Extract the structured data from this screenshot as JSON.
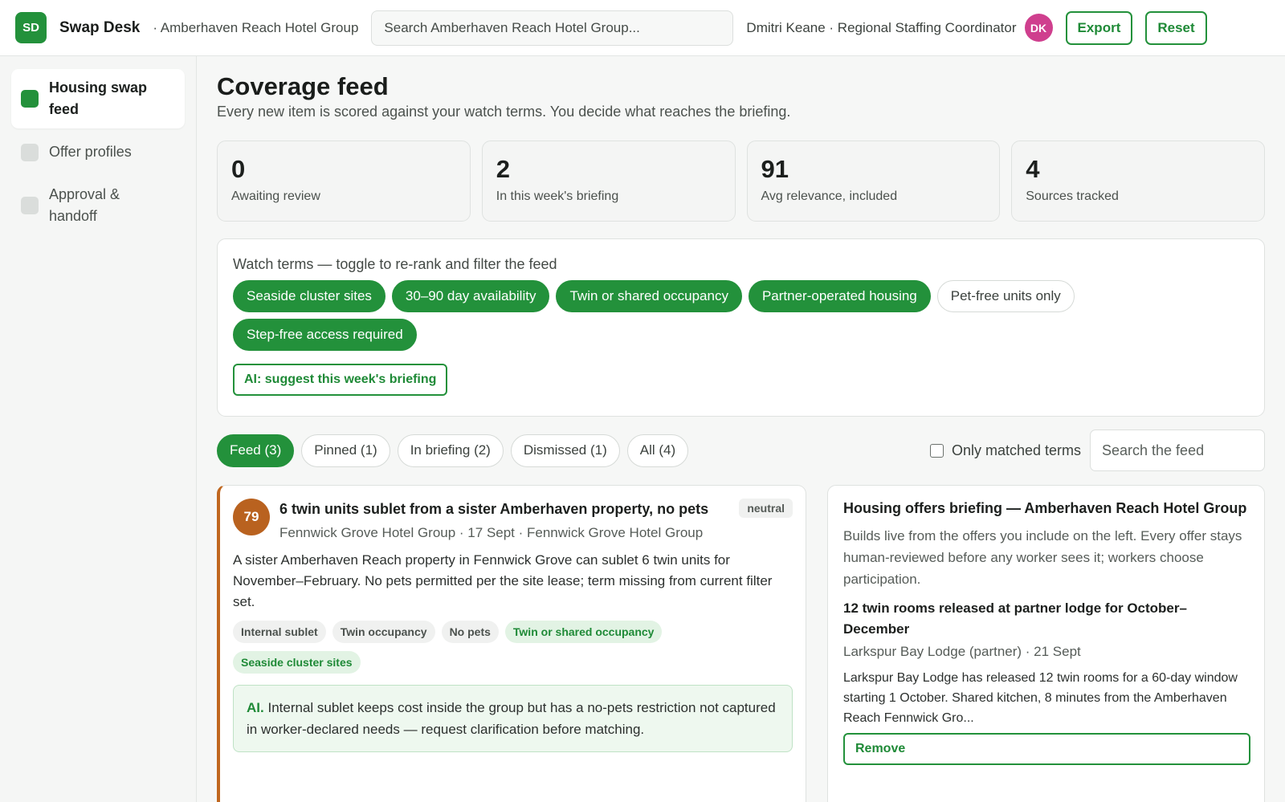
{
  "header": {
    "logo_text": "SD",
    "app_name": "Swap Desk",
    "org_name": "· Amberhaven Reach Hotel Group",
    "search_placeholder": "Search Amberhaven Reach Hotel Group...",
    "user": "Dmitri Keane · Regional Staffing Coordinator",
    "avatar_initials": "DK",
    "export_label": "Export",
    "reset_label": "Reset"
  },
  "sidebar": {
    "items": [
      {
        "label": "Housing swap feed",
        "active": true
      },
      {
        "label": "Offer profiles",
        "active": false
      },
      {
        "label": "Approval & handoff",
        "active": false
      }
    ]
  },
  "main": {
    "title": "Coverage feed",
    "subtitle": "Every new item is scored against your watch terms. You decide what reaches the briefing.",
    "stats": [
      {
        "value": "0",
        "label": "Awaiting review"
      },
      {
        "value": "2",
        "label": "In this week's briefing"
      },
      {
        "value": "91",
        "label": "Avg relevance, included"
      },
      {
        "value": "4",
        "label": "Sources tracked"
      }
    ],
    "watch": {
      "title": "Watch terms — toggle to re-rank and filter the feed",
      "terms": [
        {
          "label": "Seaside cluster sites",
          "on": true
        },
        {
          "label": "30–90 day availability",
          "on": true
        },
        {
          "label": "Twin or shared occupancy",
          "on": true
        },
        {
          "label": "Partner-operated housing",
          "on": true
        },
        {
          "label": "Pet-free units only",
          "on": false
        },
        {
          "label": "Step-free access required",
          "on": true
        }
      ],
      "ai_button": "AI: suggest this week's briefing"
    },
    "tabs": [
      {
        "label": "Feed (3)",
        "on": true
      },
      {
        "label": "Pinned (1)",
        "on": false
      },
      {
        "label": "In briefing (2)",
        "on": false
      },
      {
        "label": "Dismissed (1)",
        "on": false
      },
      {
        "label": "All (4)",
        "on": false
      }
    ],
    "only_matched_label": "Only matched terms",
    "feed_search_placeholder": "Search the feed"
  },
  "card": {
    "score": "79",
    "title": "6 twin units sublet from a sister Amberhaven property, no pets",
    "sentiment": "neutral",
    "meta": "Fennwick Grove Hotel Group · 17 Sept · Fennwick Grove Hotel Group",
    "body": "A sister Amberhaven Reach property in Fennwick Grove can sublet 6 twin units for November–February. No pets permitted per the site lease; term missing from current filter set.",
    "tags": [
      {
        "label": "Internal sublet",
        "match": false
      },
      {
        "label": "Twin occupancy",
        "match": false
      },
      {
        "label": "No pets",
        "match": false
      },
      {
        "label": "Twin or shared occupancy",
        "match": true
      },
      {
        "label": "Seaside cluster sites",
        "match": true
      }
    ],
    "ai_label": "AI.",
    "ai_text": "Internal sublet keeps cost inside the group but has a no-pets restriction not captured in worker-declared needs — request clarification before matching."
  },
  "briefing": {
    "title": "Housing offers briefing — Amberhaven Reach Hotel Group",
    "description": "Builds live from the offers you include on the left. Every offer stays human-reviewed before any worker sees it; workers choose participation.",
    "item_title": "12 twin rooms released at partner lodge for October–December",
    "item_meta": "Larkspur Bay Lodge (partner) · 21 Sept",
    "item_body": "Larkspur Bay Lodge has released 12 twin rooms for a 60-day window starting 1 October. Shared kitchen, 8 minutes from the Amberhaven Reach Fennwick Gro...",
    "remove_label": "Remove"
  }
}
